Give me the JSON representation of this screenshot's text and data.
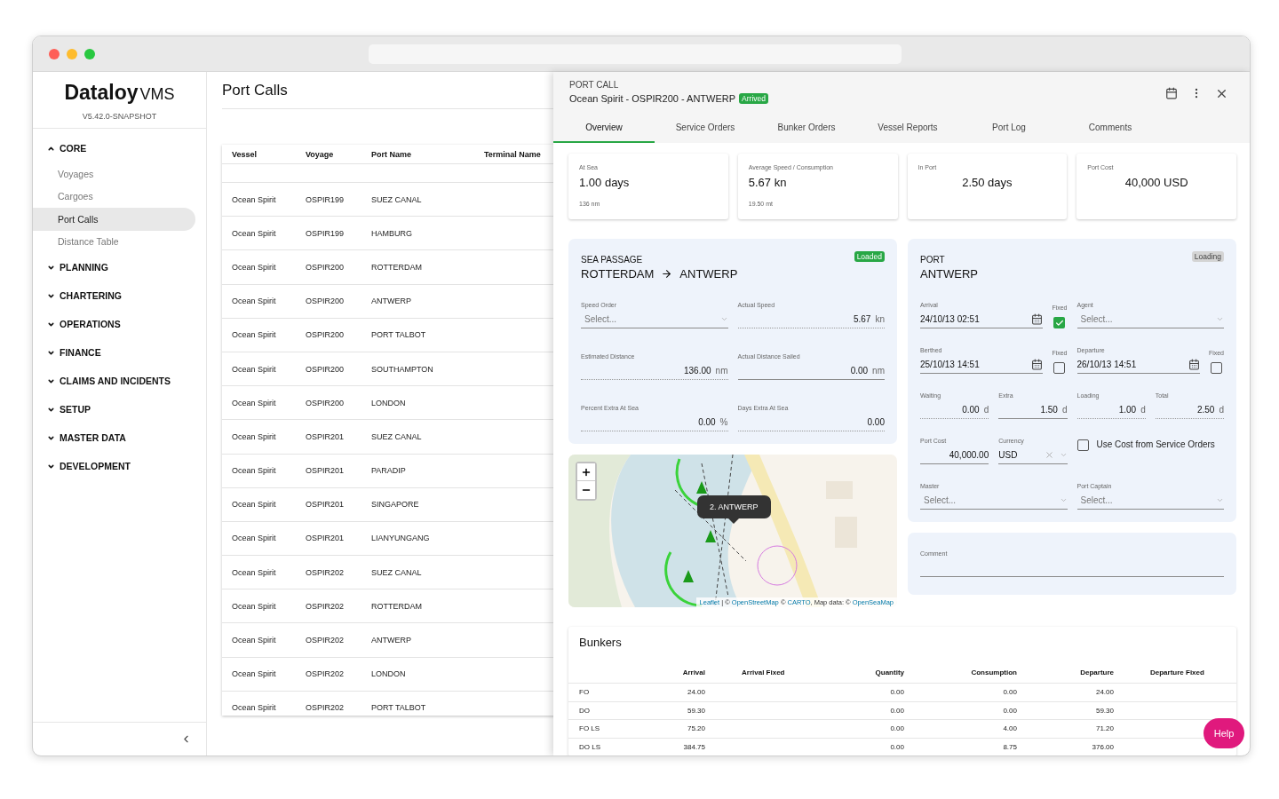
{
  "app": {
    "brand": "Dataloy",
    "product": "VMS",
    "version": "V5.42.0-SNAPSHOT"
  },
  "sidebar": {
    "sections": [
      {
        "label": "CORE",
        "expanded": true,
        "children": [
          {
            "label": "Voyages",
            "selected": false
          },
          {
            "label": "Cargoes",
            "selected": false
          },
          {
            "label": "Port Calls",
            "selected": true
          },
          {
            "label": "Distance Table",
            "selected": false
          }
        ]
      },
      {
        "label": "PLANNING",
        "expanded": false
      },
      {
        "label": "CHARTERING",
        "expanded": false
      },
      {
        "label": "OPERATIONS",
        "expanded": false
      },
      {
        "label": "FINANCE",
        "expanded": false
      },
      {
        "label": "CLAIMS AND INCIDENTS",
        "expanded": false
      },
      {
        "label": "SETUP",
        "expanded": false
      },
      {
        "label": "MASTER DATA",
        "expanded": false
      },
      {
        "label": "DEVELOPMENT",
        "expanded": false
      }
    ]
  },
  "list": {
    "title": "Port Calls",
    "columns": [
      "Vessel",
      "Voyage",
      "Port Name",
      "Terminal Name"
    ],
    "rows": [
      {
        "vessel": "Ocean Spirit",
        "voyage": "OSPIR199",
        "port": "SUEZ CANAL"
      },
      {
        "vessel": "Ocean Spirit",
        "voyage": "OSPIR199",
        "port": "HAMBURG"
      },
      {
        "vessel": "Ocean Spirit",
        "voyage": "OSPIR200",
        "port": "ROTTERDAM"
      },
      {
        "vessel": "Ocean Spirit",
        "voyage": "OSPIR200",
        "port": "ANTWERP"
      },
      {
        "vessel": "Ocean Spirit",
        "voyage": "OSPIR200",
        "port": "PORT TALBOT"
      },
      {
        "vessel": "Ocean Spirit",
        "voyage": "OSPIR200",
        "port": "SOUTHAMPTON"
      },
      {
        "vessel": "Ocean Spirit",
        "voyage": "OSPIR200",
        "port": "LONDON"
      },
      {
        "vessel": "Ocean Spirit",
        "voyage": "OSPIR201",
        "port": "SUEZ CANAL"
      },
      {
        "vessel": "Ocean Spirit",
        "voyage": "OSPIR201",
        "port": "PARADIP"
      },
      {
        "vessel": "Ocean Spirit",
        "voyage": "OSPIR201",
        "port": "SINGAPORE"
      },
      {
        "vessel": "Ocean Spirit",
        "voyage": "OSPIR201",
        "port": "LIANYUNGANG"
      },
      {
        "vessel": "Ocean Spirit",
        "voyage": "OSPIR202",
        "port": "SUEZ CANAL"
      },
      {
        "vessel": "Ocean Spirit",
        "voyage": "OSPIR202",
        "port": "ROTTERDAM"
      },
      {
        "vessel": "Ocean Spirit",
        "voyage": "OSPIR202",
        "port": "ANTWERP"
      },
      {
        "vessel": "Ocean Spirit",
        "voyage": "OSPIR202",
        "port": "LONDON"
      },
      {
        "vessel": "Ocean Spirit",
        "voyage": "OSPIR202",
        "port": "PORT TALBOT"
      }
    ]
  },
  "port_call": {
    "heading": "PORT CALL",
    "title": "Ocean Spirit - OSPIR200 - ANTWERP",
    "status": {
      "label": "Arrived",
      "color": "#28a745"
    },
    "tabs": [
      {
        "label": "Overview",
        "selected": true
      },
      {
        "label": "Service Orders",
        "selected": false
      },
      {
        "label": "Bunker Orders",
        "selected": false
      },
      {
        "label": "Vessel Reports",
        "selected": false
      },
      {
        "label": "Port Log",
        "selected": false
      },
      {
        "label": "Comments",
        "selected": false
      }
    ],
    "summary": [
      {
        "label": "At Sea",
        "value": "1.00 days",
        "detail": "136 nm"
      },
      {
        "label": "Average Speed / Consumption",
        "value": "5.67 kn",
        "detail": "19.50 mt"
      },
      {
        "label": "In Port",
        "value": "2.50 days"
      },
      {
        "label": "Port Cost",
        "value": "40,000 USD"
      }
    ],
    "sea_passage": {
      "heading": "SEA PASSAGE",
      "from": "ROTTERDAM",
      "to": "ANTWERP",
      "status": {
        "label": "Loaded",
        "color": "#28a745"
      },
      "fields": [
        {
          "kind": "select",
          "label": "Speed Order",
          "placeholder": "Select..."
        },
        {
          "kind": "number",
          "label": "Actual Speed",
          "value": "5.67",
          "unit": "kn",
          "readonly": true
        },
        {
          "kind": "number",
          "label": "Estimated Distance",
          "value": "136.00",
          "unit": "nm",
          "readonly": true
        },
        {
          "kind": "number",
          "label": "Actual Distance Sailed",
          "value": "0.00",
          "unit": "nm",
          "readonly": false
        },
        {
          "kind": "number",
          "label": "Percent Extra At Sea",
          "value": "0.00",
          "unit": "%",
          "readonly": true
        },
        {
          "kind": "number",
          "label": "Days Extra At Sea",
          "value": "0.00",
          "readonly": true
        }
      ]
    },
    "map": {
      "popup": "2. ANTWERP",
      "attribution": [
        {
          "text": "Leaflet",
          "link": true
        },
        {
          "text": " | © ",
          "link": false
        },
        {
          "text": "OpenStreetMap",
          "link": true
        },
        {
          "text": " © ",
          "link": false
        },
        {
          "text": "CARTO",
          "link": true
        },
        {
          "text": ", Map data: © ",
          "link": false
        },
        {
          "text": "OpenSeaMap",
          "link": true
        }
      ]
    },
    "port": {
      "heading": "PORT",
      "name": "ANTWERP",
      "status": {
        "label": "Loading",
        "color": "#d4d4d4"
      },
      "rows": [
        [
          {
            "kind": "date",
            "label": "Arrival",
            "value": "24/10/13 02:51",
            "fixed_label": "Fixed",
            "fixed": true
          },
          {
            "kind": "select",
            "label": "Agent",
            "placeholder": "Select..."
          }
        ],
        [
          {
            "kind": "date",
            "label": "Berthed",
            "value": "25/10/13 14:51",
            "fixed_label": "Fixed",
            "fixed": false
          },
          {
            "kind": "date",
            "label": "Departure",
            "value": "26/10/13 14:51",
            "fixed_label": "Fixed",
            "fixed": false
          }
        ],
        [
          {
            "kind": "number",
            "label": "Waiting",
            "value": "0.00",
            "unit": "d",
            "readonly": true
          },
          {
            "kind": "number",
            "label": "Extra",
            "value": "1.50",
            "unit": "d",
            "readonly": false
          },
          {
            "kind": "number",
            "label": "Loading",
            "value": "1.00",
            "unit": "d",
            "readonly": true
          },
          {
            "kind": "number",
            "label": "Total",
            "value": "2.50",
            "unit": "d",
            "readonly": true
          }
        ],
        [
          {
            "kind": "number",
            "label": "Port Cost",
            "value": "40,000.00",
            "readonly": false
          },
          {
            "kind": "currency",
            "label": "Currency",
            "value": "USD"
          },
          {
            "kind": "checkbox",
            "label": "Use Cost from Service Orders",
            "checked": false
          }
        ],
        [
          {
            "kind": "select",
            "label": "Master",
            "placeholder": "Select..."
          },
          {
            "kind": "select",
            "label": "Port Captain",
            "placeholder": "Select..."
          }
        ]
      ]
    },
    "comment": {
      "label": "Comment"
    },
    "bunkers": {
      "title": "Bunkers",
      "columns": [
        "Arrival",
        "Arrival Fixed",
        "Quantity",
        "Consumption",
        "Departure",
        "Departure Fixed"
      ],
      "rows": [
        {
          "grade": "FO",
          "arrival": "24.00",
          "quantity": "0.00",
          "consumption": "0.00",
          "departure": "24.00"
        },
        {
          "grade": "DO",
          "arrival": "59.30",
          "quantity": "0.00",
          "consumption": "0.00",
          "departure": "59.30"
        },
        {
          "grade": "FO LS",
          "arrival": "75.20",
          "quantity": "0.00",
          "consumption": "4.00",
          "departure": "71.20"
        },
        {
          "grade": "DO LS",
          "arrival": "384.75",
          "quantity": "0.00",
          "consumption": "8.75",
          "departure": "376.00"
        }
      ]
    }
  },
  "help": {
    "label": "Help"
  }
}
